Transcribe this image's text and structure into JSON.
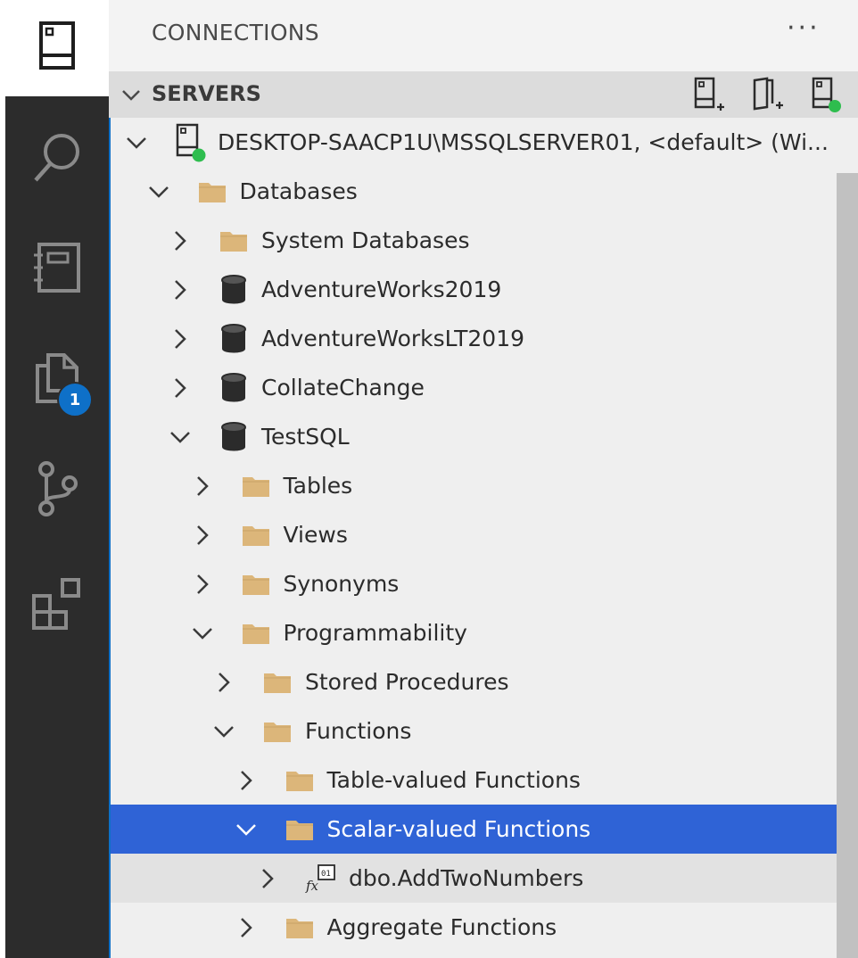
{
  "activity_bar": {
    "items": [
      {
        "icon": "servers-icon",
        "active": true
      },
      {
        "icon": "search-icon"
      },
      {
        "icon": "notebook-icon"
      },
      {
        "icon": "explorer-icon",
        "badge": "1"
      },
      {
        "icon": "source-control-icon"
      },
      {
        "icon": "extensions-icon"
      }
    ]
  },
  "sidebar": {
    "title": "CONNECTIONS",
    "more": "···",
    "section": {
      "label": "SERVERS",
      "actions": [
        "new-connection-icon",
        "new-server-group-icon",
        "active-connections-icon"
      ]
    },
    "tree": [
      {
        "label": "DESKTOP-SAACP1U\\MSSQLSERVER01, <default> (Wi...",
        "icon": "server",
        "level": 0,
        "expanded": true
      },
      {
        "label": "Databases",
        "icon": "folder",
        "level": 1,
        "expanded": true
      },
      {
        "label": "System Databases",
        "icon": "folder",
        "level": 2,
        "expanded": false
      },
      {
        "label": "AdventureWorks2019",
        "icon": "database",
        "level": 2,
        "expanded": false
      },
      {
        "label": "AdventureWorksLT2019",
        "icon": "database",
        "level": 2,
        "expanded": false
      },
      {
        "label": "CollateChange",
        "icon": "database",
        "level": 2,
        "expanded": false
      },
      {
        "label": "TestSQL",
        "icon": "database",
        "level": 2,
        "expanded": true
      },
      {
        "label": "Tables",
        "icon": "folder",
        "level": 3,
        "expanded": false
      },
      {
        "label": "Views",
        "icon": "folder",
        "level": 3,
        "expanded": false
      },
      {
        "label": "Synonyms",
        "icon": "folder",
        "level": 3,
        "expanded": false
      },
      {
        "label": "Programmability",
        "icon": "folder",
        "level": 3,
        "expanded": true
      },
      {
        "label": "Stored Procedures",
        "icon": "folder",
        "level": 4,
        "expanded": false
      },
      {
        "label": "Functions",
        "icon": "folder",
        "level": 4,
        "expanded": true
      },
      {
        "label": "Table-valued Functions",
        "icon": "folder",
        "level": 5,
        "expanded": false
      },
      {
        "label": "Scalar-valued Functions",
        "icon": "folder",
        "level": 5,
        "expanded": true,
        "selected": true
      },
      {
        "label": "dbo.AddTwoNumbers",
        "icon": "function",
        "level": 6,
        "expanded": false,
        "hover": true
      },
      {
        "label": "Aggregate Functions",
        "icon": "folder",
        "level": 5,
        "expanded": false
      }
    ]
  },
  "colors": {
    "activity_bg": "#2c2c2c",
    "selection": "#2f63d6",
    "badge": "#0e70c8",
    "connected_dot": "#2ebd4e",
    "folder": "#dcb67a"
  }
}
